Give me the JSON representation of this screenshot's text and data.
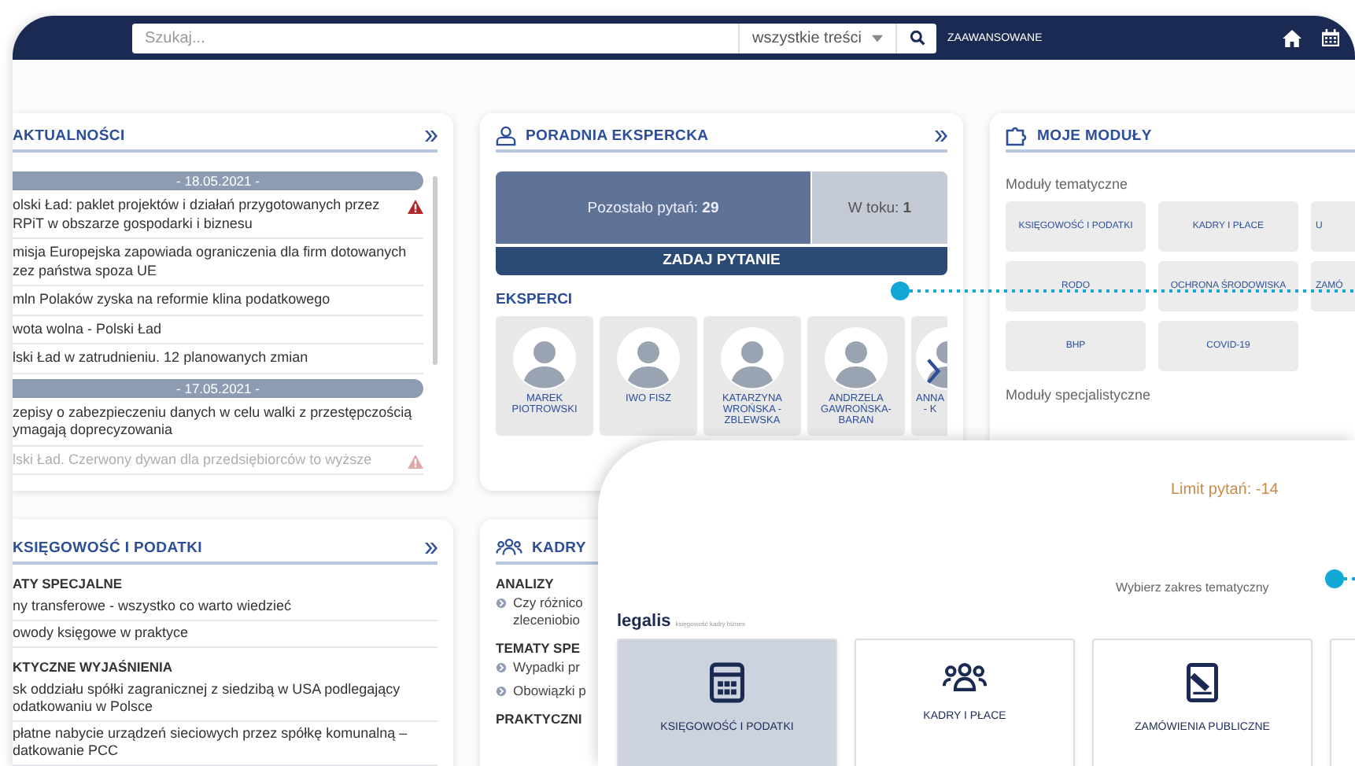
{
  "header": {
    "search": {
      "placeholder": "Szukaj..."
    },
    "scope": {
      "value": "wszystkie treści"
    },
    "advanced_link": "ZAAWANSOWANE"
  },
  "news": {
    "title": "AKTUALNOŚCI",
    "groups": [
      {
        "date": "- 18.05.2021 -",
        "items": [
          {
            "lines": [
              "olski Ład: paklet projektów i działań przygotowanych przez",
              "RPiT w obszarze gospodarki i biznesu"
            ],
            "alert": true,
            "faded": false
          },
          {
            "lines": [
              "misja Europejska zapowiada ograniczenia dla firm dotowanych",
              "zez państwa spoza UE"
            ],
            "alert": false,
            "faded": false
          },
          {
            "lines": [
              "mln Polaków zyska na reformie klina podatkowego"
            ],
            "alert": false,
            "faded": false
          },
          {
            "lines": [
              "wota wolna - Polski Ład"
            ],
            "alert": false,
            "faded": false
          },
          {
            "lines": [
              "lski Ład w zatrudnieniu. 12 planowanych zmian"
            ],
            "alert": false,
            "faded": false
          }
        ]
      },
      {
        "date": "- 17.05.2021 -",
        "items": [
          {
            "lines": [
              "zepisy o zabezpieczeniu danych w celu walki z przestępczością",
              "ymagają doprecyzowania"
            ],
            "alert": false,
            "faded": false
          },
          {
            "lines": [
              "lski Ład. Czerwony dywan dla przedsiębiorców to wyższe"
            ],
            "alert": true,
            "faded": true
          }
        ]
      }
    ]
  },
  "accounting": {
    "title": "KSIĘGOWOŚĆ I PODATKI",
    "sections": [
      {
        "heading": "ATY SPECJALNE",
        "items": [
          {
            "lines": [
              "ny transferowe - wszystko co warto wiedzieć"
            ]
          },
          {
            "lines": [
              "owody księgowe w praktyce"
            ]
          }
        ]
      },
      {
        "heading": "KTYCZNE WYJAŚNIENIA",
        "items": [
          {
            "lines": [
              "sk oddziału spółki zagranicznej z siedzibą w USA podlegający",
              "odatkowaniu w Polsce"
            ]
          },
          {
            "lines": [
              "płatne nabycie urządzeń sieciowych przez spółkę komunalną –",
              "datkowanie PCC"
            ]
          }
        ]
      }
    ]
  },
  "advice": {
    "title": "PORADNIA EKSPERCKA",
    "remaining": "Pozostało pytań: **29**",
    "in_progress": "W toku: **1**",
    "ask_button": "ZADAJ PYTANIE",
    "experts_heading": "EKSPERCI",
    "experts": [
      {
        "name": [
          "MAREK",
          "PIOTROWSKI"
        ]
      },
      {
        "name": [
          "IWO FISZ"
        ]
      },
      {
        "name": [
          "KATARZYNA",
          "WROŃSKA -",
          "ZBLEWSKA"
        ]
      },
      {
        "name": [
          "ANDRZELA",
          "GAWROŃSKA-",
          "BARAN"
        ]
      },
      {
        "name": [
          "ANNA",
          "- K"
        ]
      }
    ]
  },
  "hr": {
    "title": "KADRY",
    "sections": [
      {
        "heading": "ANALIZY",
        "items": [
          {
            "lines": [
              "Czy różnico",
              "zleceniobio"
            ]
          }
        ]
      },
      {
        "heading": "TEMATY SPE",
        "items": [
          {
            "lines": [
              "Wypadki pr"
            ]
          },
          {
            "lines": [
              "Obowiązki p"
            ]
          }
        ]
      },
      {
        "heading": "PRAKTYCZNI"
      }
    ]
  },
  "modules": {
    "title": "MOJE MODUŁY",
    "groups": [
      {
        "label": "Moduły tematyczne",
        "tiles": [
          {
            "label": "KSIĘGOWOŚĆ I PODATKI"
          },
          {
            "label": "KADRY I PŁACE"
          },
          {
            "label": "U"
          },
          {
            "label": "RODO"
          },
          {
            "label": "OCHRONA ŚRODOWISKA"
          },
          {
            "label": "ZAMÓ"
          },
          {
            "label": "BHP"
          },
          {
            "label": "COVID-19"
          }
        ]
      },
      {
        "label": "Moduły specjalistyczne"
      }
    ]
  },
  "overlay": {
    "limit": "Limit pytań: -14",
    "prompt": "Wybierz zakres tematyczny",
    "brand": "legalis",
    "brand_tagline": "księgowość kadry biznes",
    "tiles": [
      {
        "label": "KSIĘGOWOŚĆ I PODATKI",
        "kind": "calculator",
        "selected": true
      },
      {
        "label": "KADRY I PŁACE",
        "kind": "people",
        "selected": false
      },
      {
        "label": "ZAMÓWIENIA PUBLICZNE",
        "kind": "document",
        "selected": false
      },
      {
        "kind": "blank",
        "selected": false
      }
    ]
  }
}
